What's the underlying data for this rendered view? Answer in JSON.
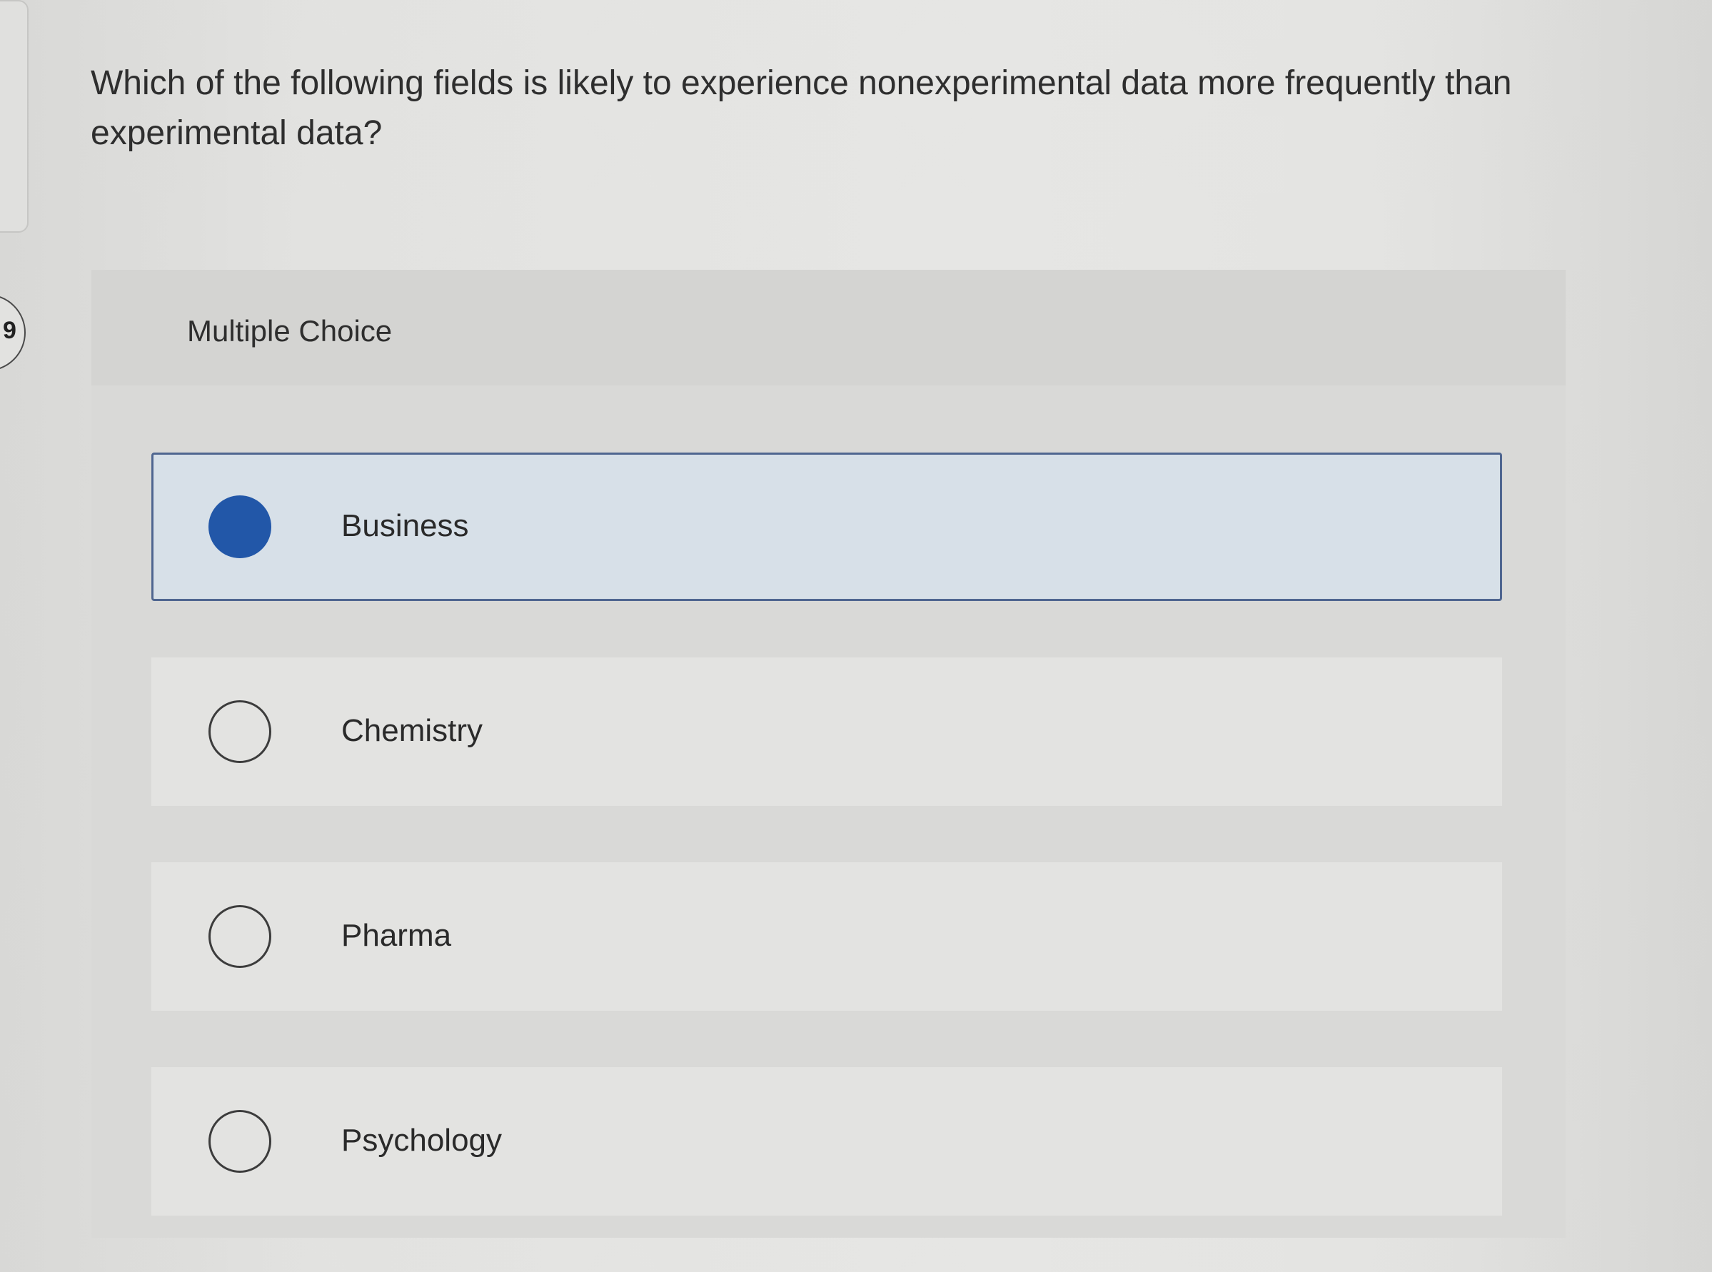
{
  "question": {
    "number": "9",
    "text": "Which of the following fields is likely to experience nonexperimental data more frequently than experimental data?"
  },
  "choice_block": {
    "header": "Multiple Choice"
  },
  "options": [
    {
      "label": "Business",
      "selected": true
    },
    {
      "label": "Chemistry",
      "selected": false
    },
    {
      "label": "Pharma",
      "selected": false
    },
    {
      "label": "Psychology",
      "selected": false
    }
  ],
  "colors": {
    "accent": "#2257a8",
    "selected_border": "#4f6690",
    "selected_background": "#d7e0e8"
  },
  "icons": {
    "selected_radio": "radio-filled-icon",
    "unselected_radio": "radio-empty-icon"
  }
}
